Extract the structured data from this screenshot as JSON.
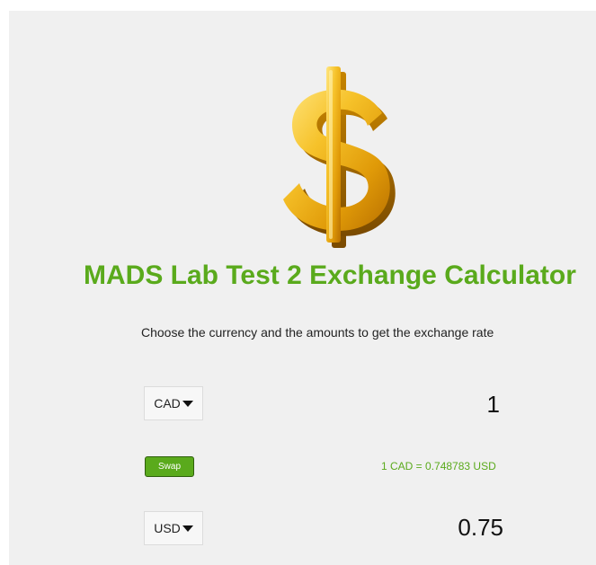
{
  "header": {
    "logo_icon": "dollar-sign-icon",
    "title": "MADS Lab Test 2 Exchange Calculator",
    "subtitle": "Choose the currency and the amounts to get the exchange rate"
  },
  "converter": {
    "from_currency": "CAD",
    "from_amount": "1",
    "swap_label": "Swap",
    "rate_text": "1 CAD = 0.748783 USD",
    "to_currency": "USD",
    "to_amount": "0.75"
  },
  "colors": {
    "accent": "#5aaa1c",
    "panel_background": "#f0f0f0",
    "gold": "#f2b51b"
  }
}
